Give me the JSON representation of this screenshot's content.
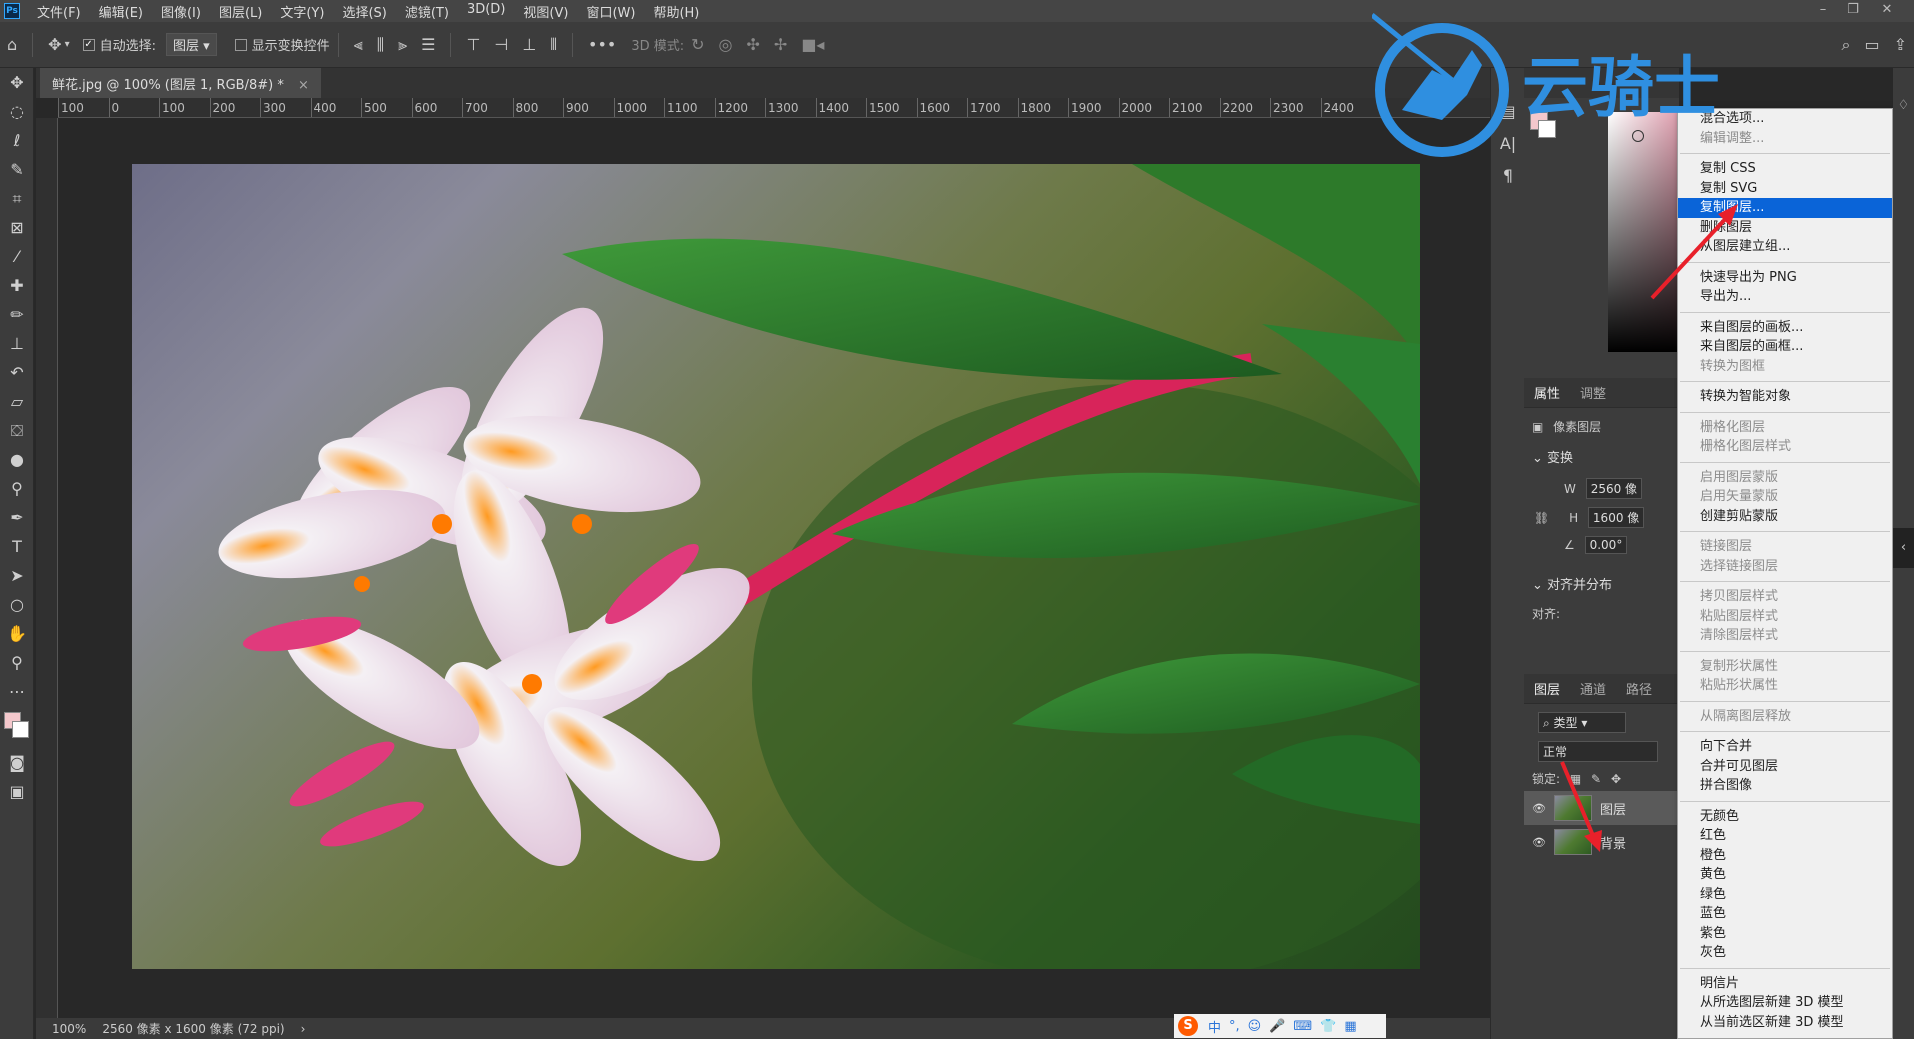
{
  "menubar": {
    "logo": "Ps",
    "items": [
      "文件(F)",
      "编辑(E)",
      "图像(I)",
      "图层(L)",
      "文字(Y)",
      "选择(S)",
      "滤镜(T)",
      "3D(D)",
      "视图(V)",
      "窗口(W)",
      "帮助(H)"
    ],
    "minimize": "–",
    "restore": "❐",
    "close": "✕"
  },
  "options": {
    "auto_select_label": "自动选择:",
    "auto_select_checked": "✓",
    "target": "图层",
    "show_transform_label": "显示变换控件",
    "mode_label": "3D 模式:",
    "more": "•••"
  },
  "document": {
    "tab_title": "鲜花.jpg @ 100% (图层 1, RGB/8#) *",
    "tab_close": "×",
    "ruler_ticks": [
      "100",
      "0",
      "100",
      "200",
      "300",
      "400",
      "500",
      "600",
      "700",
      "800",
      "900",
      "1000",
      "1100",
      "1200",
      "1300",
      "1400",
      "1500",
      "1600",
      "1700",
      "1800",
      "1900",
      "2000",
      "2100",
      "2200",
      "2300",
      "2400"
    ]
  },
  "status": {
    "zoom": "100%",
    "doc_info": "2560 像素 x 1600 像素 (72 ppi)",
    "arrow": "›"
  },
  "ime": {
    "logo": "S",
    "lang": "中",
    "punct": "°,",
    "emoji": "☺",
    "mic": "🎤",
    "keyboard": "⌨",
    "skin": "👕",
    "grid": "▦"
  },
  "watermark": {
    "text": "云骑士",
    "color": "#2f8fe0"
  },
  "properties": {
    "tab_props": "属性",
    "tab_adjust": "调整",
    "pixel_layer": "像素图层",
    "transform": "变换",
    "w_label": "W",
    "w_value": "2560 像",
    "h_label": "H",
    "h_value": "1600 像",
    "angle": "0.00°",
    "align_section": "对齐并分布",
    "align_label": "对齐:"
  },
  "layers": {
    "tab_layers": "图层",
    "tab_channels": "通道",
    "tab_paths": "路径",
    "filter": "类型",
    "blend": "正常",
    "lock_label": "锁定:",
    "rows": [
      {
        "name": "图层",
        "visible": "👁"
      },
      {
        "name": "背景",
        "visible": "👁"
      }
    ]
  },
  "context_menu": {
    "groups": [
      [
        {
          "label": "混合选项...",
          "enabled": true
        },
        {
          "label": "编辑调整...",
          "enabled": false
        }
      ],
      [
        {
          "label": "复制 CSS",
          "enabled": true
        },
        {
          "label": "复制 SVG",
          "enabled": true
        },
        {
          "label": "复制图层...",
          "enabled": true,
          "highlight": true
        },
        {
          "label": "删除图层",
          "enabled": true
        },
        {
          "label": "从图层建立组...",
          "enabled": true
        }
      ],
      [
        {
          "label": "快速导出为 PNG",
          "enabled": true
        },
        {
          "label": "导出为...",
          "enabled": true
        }
      ],
      [
        {
          "label": "来自图层的画板...",
          "enabled": true
        },
        {
          "label": "来自图层的画框...",
          "enabled": true
        },
        {
          "label": "转换为图框",
          "enabled": false
        }
      ],
      [
        {
          "label": "转换为智能对象",
          "enabled": true
        }
      ],
      [
        {
          "label": "栅格化图层",
          "enabled": false
        },
        {
          "label": "栅格化图层样式",
          "enabled": false
        }
      ],
      [
        {
          "label": "启用图层蒙版",
          "enabled": false
        },
        {
          "label": "启用矢量蒙版",
          "enabled": false
        },
        {
          "label": "创建剪贴蒙版",
          "enabled": true
        }
      ],
      [
        {
          "label": "链接图层",
          "enabled": false
        },
        {
          "label": "选择链接图层",
          "enabled": false
        }
      ],
      [
        {
          "label": "拷贝图层样式",
          "enabled": false
        },
        {
          "label": "粘贴图层样式",
          "enabled": false
        },
        {
          "label": "清除图层样式",
          "enabled": false
        }
      ],
      [
        {
          "label": "复制形状属性",
          "enabled": false
        },
        {
          "label": "粘贴形状属性",
          "enabled": false
        }
      ],
      [
        {
          "label": "从隔离图层释放",
          "enabled": false
        }
      ],
      [
        {
          "label": "向下合并",
          "enabled": true
        },
        {
          "label": "合并可见图层",
          "enabled": true
        },
        {
          "label": "拼合图像",
          "enabled": true
        }
      ],
      [
        {
          "label": "无颜色",
          "enabled": true
        },
        {
          "label": "红色",
          "enabled": true
        },
        {
          "label": "橙色",
          "enabled": true
        },
        {
          "label": "黄色",
          "enabled": true
        },
        {
          "label": "绿色",
          "enabled": true
        },
        {
          "label": "蓝色",
          "enabled": true
        },
        {
          "label": "紫色",
          "enabled": true
        },
        {
          "label": "灰色",
          "enabled": true
        }
      ],
      [
        {
          "label": "明信片",
          "enabled": true
        },
        {
          "label": "从所选图层新建 3D 模型",
          "enabled": true
        },
        {
          "label": "从当前选区新建 3D 模型",
          "enabled": true
        }
      ]
    ]
  },
  "colors": {
    "highlight": "#0a64d8",
    "arrow": "#e8202a",
    "foreground": "#f4c8cc",
    "background": "#ffffff"
  }
}
